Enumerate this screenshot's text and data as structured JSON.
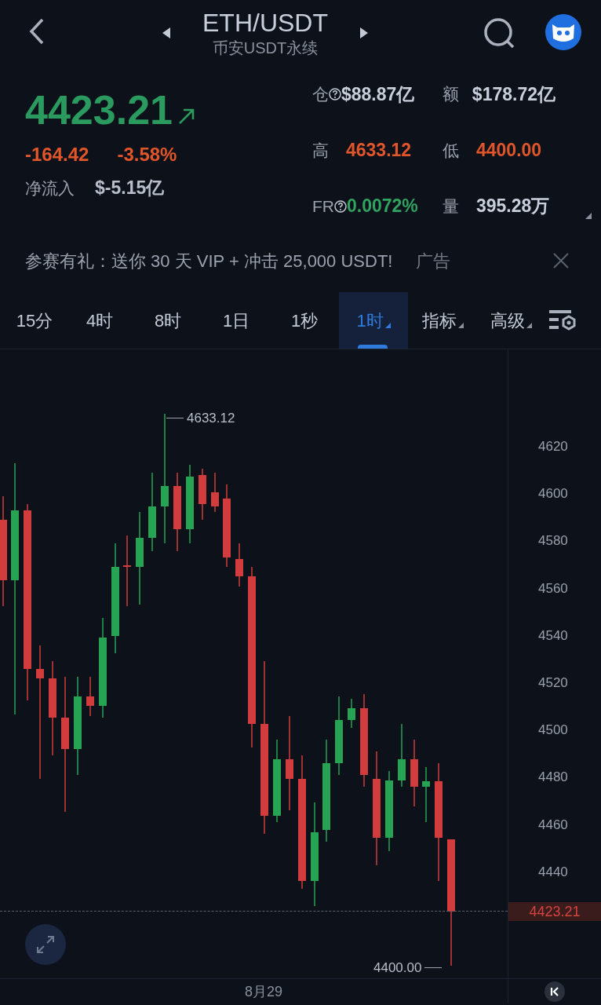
{
  "header": {
    "title": "ETH/USDT",
    "subtitle": "币安USDT永续"
  },
  "ticker": {
    "price": "4423.21",
    "color": "#2a9a5f",
    "change": "-164.42",
    "change_percent": "-3.58%",
    "net_inflow_label": "净流入",
    "net_inflow": "$-5.15亿"
  },
  "stats": [
    {
      "label": "仓",
      "info": true,
      "value": "$88.87亿",
      "color": "#c8cfda"
    },
    {
      "label": "额",
      "info": false,
      "value": "$178.72亿",
      "color": "#c8cfda"
    },
    {
      "label": "高",
      "info": false,
      "value": "4633.12",
      "color": "#e0562a"
    },
    {
      "label": "低",
      "info": false,
      "value": "4400.00",
      "color": "#e0562a"
    },
    {
      "label": "FR",
      "info": true,
      "value": "0.0072%",
      "color": "#2fa35f"
    },
    {
      "label": "量",
      "info": false,
      "value": "395.28万",
      "color": "#c8cfda"
    }
  ],
  "ad": {
    "text": "参赛有礼：送你 30 天 VIP + 冲击 25,000 USDT!",
    "tag": "广告"
  },
  "intervals": [
    {
      "label": "15分",
      "selected": false,
      "dropdown": false
    },
    {
      "label": "4时",
      "selected": false,
      "dropdown": false
    },
    {
      "label": "8时",
      "selected": false,
      "dropdown": false
    },
    {
      "label": "1日",
      "selected": false,
      "dropdown": false
    },
    {
      "label": "1秒",
      "selected": false,
      "dropdown": false
    },
    {
      "label": "1时",
      "selected": true,
      "dropdown": true
    },
    {
      "label": "指标",
      "selected": false,
      "dropdown": true
    },
    {
      "label": "高级",
      "selected": false,
      "dropdown": true
    }
  ],
  "chart": {
    "y_labels": [
      "4620",
      "4600",
      "4580",
      "4560",
      "4540",
      "4520",
      "4500",
      "4480",
      "4460",
      "4440"
    ],
    "high_label": "4633.12",
    "low_label": "4400.00",
    "last_price": "4423.21",
    "x_labels": [
      "8月29"
    ]
  }
}
